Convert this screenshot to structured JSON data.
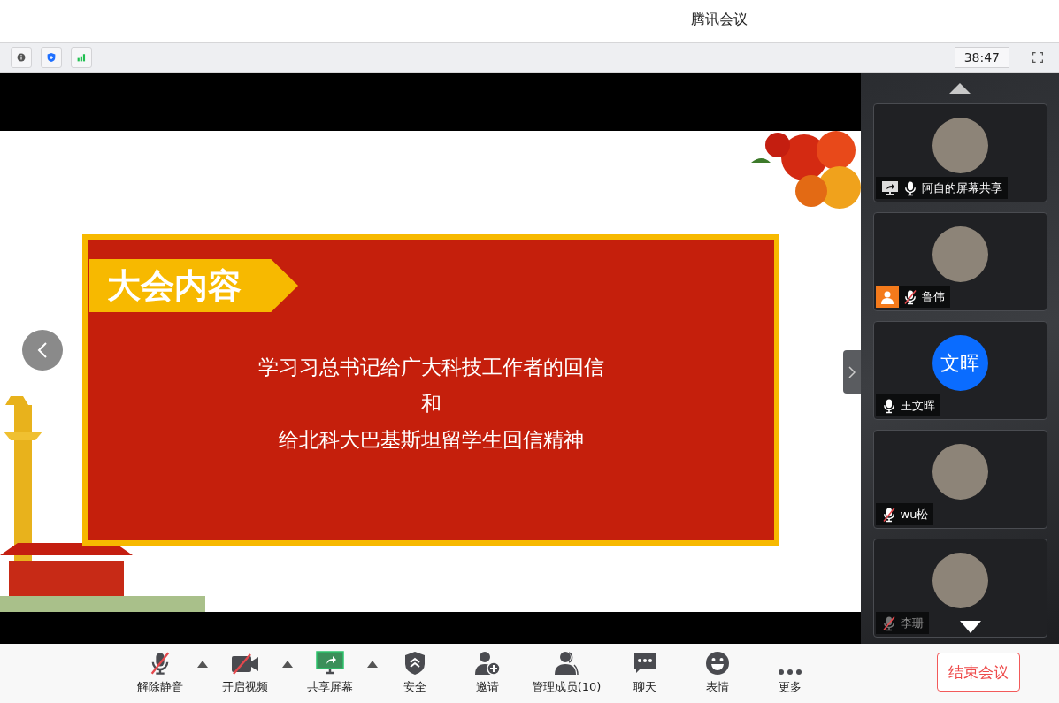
{
  "window": {
    "title": "腾讯会议"
  },
  "info_bar": {
    "timer": "38:47"
  },
  "slide": {
    "tag": "大会内容",
    "lines": [
      "学习习总书记给广大科技工作者的回信",
      "和",
      "给北科大巴基斯坦留学生回信精神"
    ]
  },
  "participants": [
    {
      "name": "阿自的屏幕共享",
      "kind": "photo",
      "sharing": true,
      "host": false,
      "muted": false,
      "dimmed": false
    },
    {
      "name": "鲁伟",
      "kind": "photo",
      "sharing": false,
      "host": true,
      "muted": true,
      "dimmed": false
    },
    {
      "name": "王文晖",
      "kind": "initials",
      "initials": "文晖",
      "sharing": false,
      "host": false,
      "muted": false,
      "dimmed": false
    },
    {
      "name": "wu松",
      "kind": "photo",
      "sharing": false,
      "host": false,
      "muted": true,
      "dimmed": false
    },
    {
      "name": "李珊",
      "kind": "photo",
      "sharing": false,
      "host": false,
      "muted": true,
      "dimmed": true
    }
  ],
  "toolbar": [
    {
      "kind": "mic",
      "label": "解除静音",
      "off": true,
      "menu": true
    },
    {
      "kind": "video",
      "label": "开启视频",
      "off": true,
      "menu": true
    },
    {
      "kind": "share",
      "label": "共享屏幕",
      "menu": true
    },
    {
      "kind": "security",
      "label": "安全",
      "menu": false
    },
    {
      "kind": "invite",
      "label": "邀请",
      "menu": false
    },
    {
      "kind": "members",
      "label": "管理成员(10)",
      "menu": false
    },
    {
      "kind": "chat",
      "label": "聊天",
      "menu": false
    },
    {
      "kind": "emoji",
      "label": "表情",
      "menu": false
    },
    {
      "kind": "more",
      "label": "更多",
      "menu": false
    }
  ],
  "end_button": "结束会议"
}
